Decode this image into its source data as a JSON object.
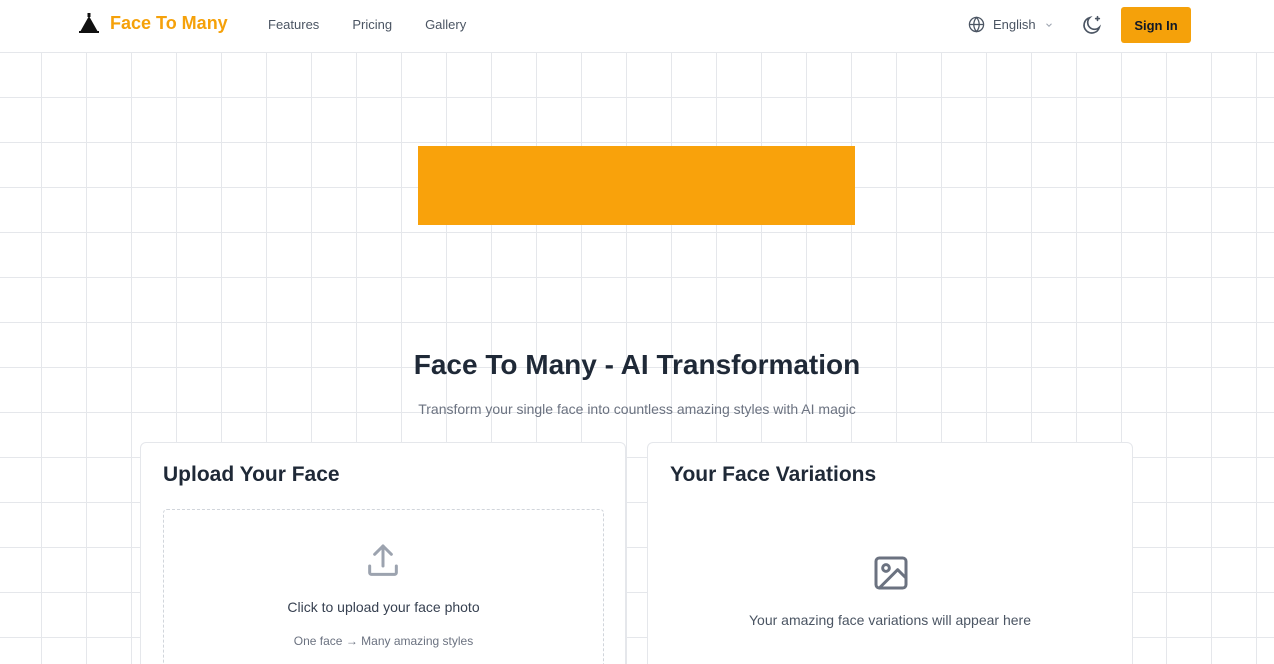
{
  "brand": {
    "name": "Face To Many",
    "color": "#f5a10a"
  },
  "nav": {
    "features": "Features",
    "pricing": "Pricing",
    "gallery": "Gallery"
  },
  "language": {
    "label": "English"
  },
  "auth": {
    "signin_label": "Sign In"
  },
  "hero": {
    "title": "Face To Many - AI Transformation",
    "subtitle": "Transform your single face into countless amazing styles with AI magic"
  },
  "upload": {
    "title": "Upload Your Face",
    "prompt": "Click to upload your face photo",
    "hint": "One face → Many amazing styles"
  },
  "variations": {
    "title": "Your Face Variations",
    "placeholder": "Your amazing face variations will appear here"
  },
  "icons": {
    "logo": "triangle-logo-icon",
    "globe": "globe-icon",
    "chevron": "chevron-down-icon",
    "theme": "moon-sparkle-icon",
    "upload": "upload-icon",
    "image": "image-icon"
  },
  "colors": {
    "accent": "#f5a10a",
    "banner": "#f9a20b"
  }
}
